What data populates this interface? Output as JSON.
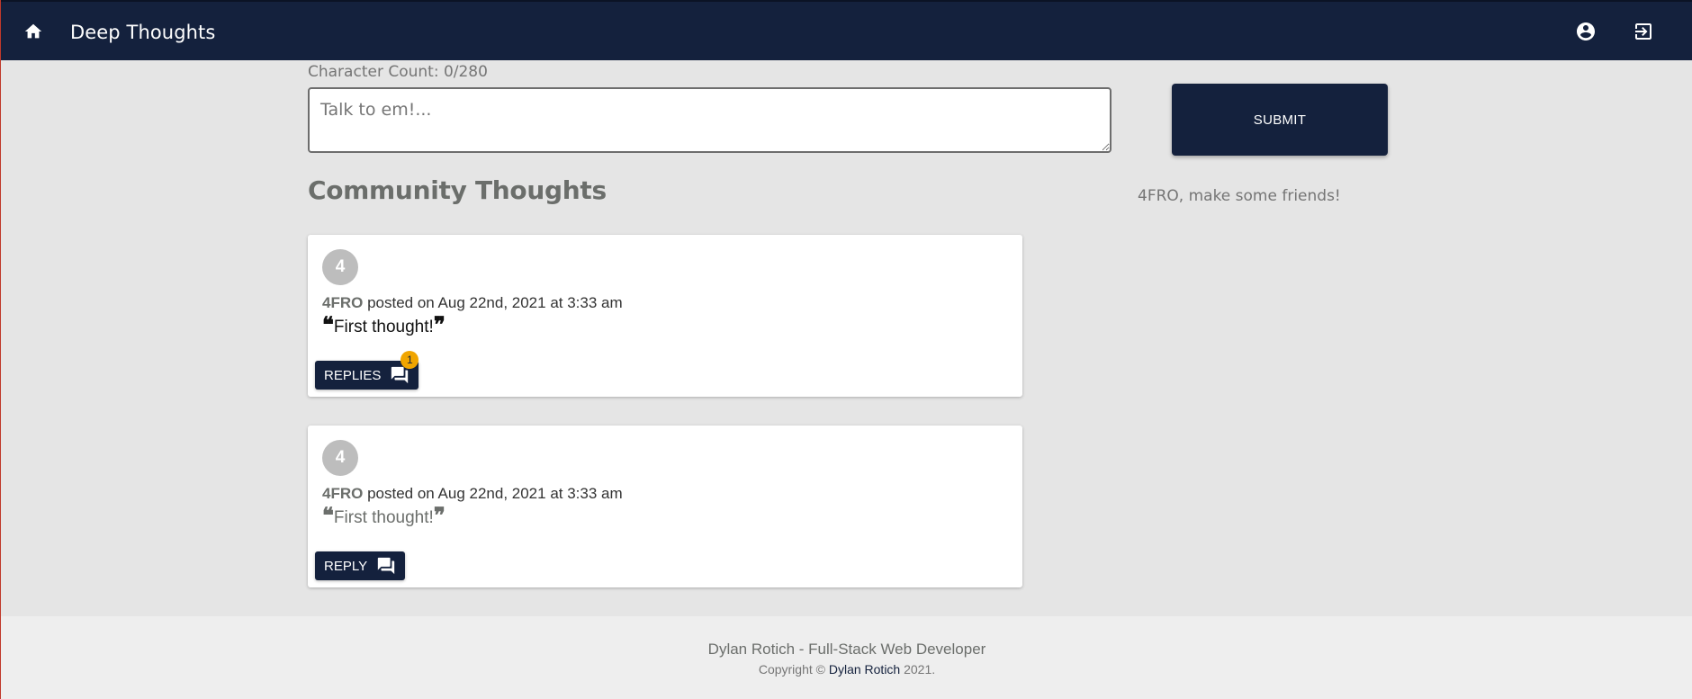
{
  "header": {
    "title": "Deep Thoughts",
    "icons": [
      "home-icon",
      "account-circle-icon",
      "logout-icon"
    ],
    "background": "#14213d"
  },
  "composer": {
    "char_count": "Character Count: 0/280",
    "placeholder": "Talk to em!...",
    "submit_label": "SUBMIT"
  },
  "main": {
    "section_title": "Community Thoughts",
    "friends_message": "4FRO, make some friends!"
  },
  "thoughts": [
    {
      "avatar": "4",
      "author": "4FRO",
      "posted": "posted on Aug 22nd, 2021 at 3:33 am",
      "text": "First thought! ",
      "button_label": "REPLIES",
      "badge": "1"
    },
    {
      "avatar": "4",
      "author": "4FRO",
      "posted": "posted on Aug 22nd, 2021 at 3:33 am",
      "text": "First thought!",
      "button_label": "REPLY"
    }
  ],
  "footer": {
    "line1": "Dylan Rotich - Full-Stack Web Developer",
    "copyright_prefix": "Copyright ©",
    "copyright_name": "Dylan Rotich",
    "copyright_year": "2021."
  },
  "colors": {
    "primary": "#14213d",
    "accent": "#f0a500",
    "page_bg": "#e5e5e5"
  }
}
